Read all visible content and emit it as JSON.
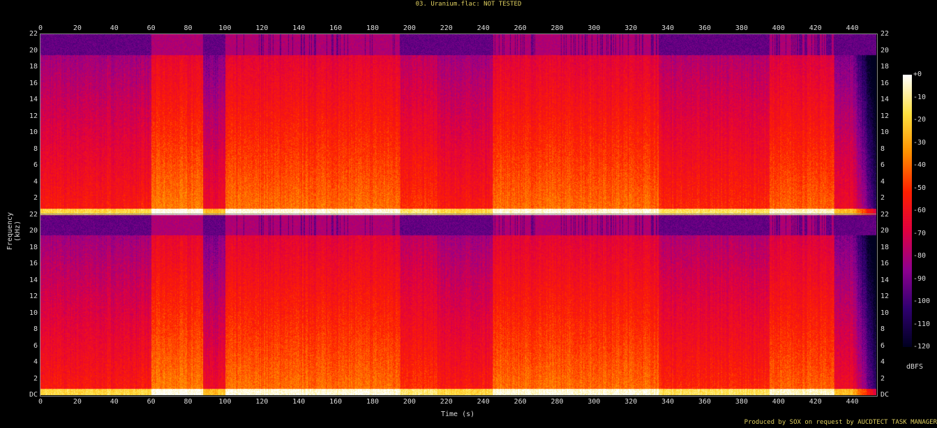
{
  "title": "03. Uranium.flac: NOT TESTED",
  "footer": "Produced by SOX on request by AUCDTECT TASK MANAGER",
  "chart_data": {
    "type": "heatmap",
    "xlabel": "Time (s)",
    "ylabel": "Frequency (kHz)",
    "xlim": [
      0,
      453
    ],
    "ylim": [
      0,
      22
    ],
    "x_ticks": [
      "0",
      "20",
      "40",
      "60",
      "80",
      "100",
      "120",
      "140",
      "160",
      "180",
      "200",
      "220",
      "240",
      "260",
      "280",
      "300",
      "320",
      "340",
      "360",
      "380",
      "400",
      "420",
      "440"
    ],
    "y_ticks": [
      "DC",
      "2",
      "4",
      "6",
      "8",
      "10",
      "12",
      "14",
      "16",
      "18",
      "20",
      "22"
    ],
    "channels": 2,
    "lowpass_cutoff_khz": 19.5,
    "colorbar": {
      "label": "dBFS",
      "range": [
        -120,
        0
      ],
      "ticks": [
        "+0",
        "-10",
        "-20",
        "-30",
        "-40",
        "-50",
        "-60",
        "-70",
        "-80",
        "-90",
        "-100",
        "-110",
        "-120"
      ],
      "colors": [
        "#ffffff",
        "#ffe040",
        "#ff9000",
        "#ff2000",
        "#e00040",
        "#900090",
        "#300070",
        "#000020"
      ]
    }
  }
}
